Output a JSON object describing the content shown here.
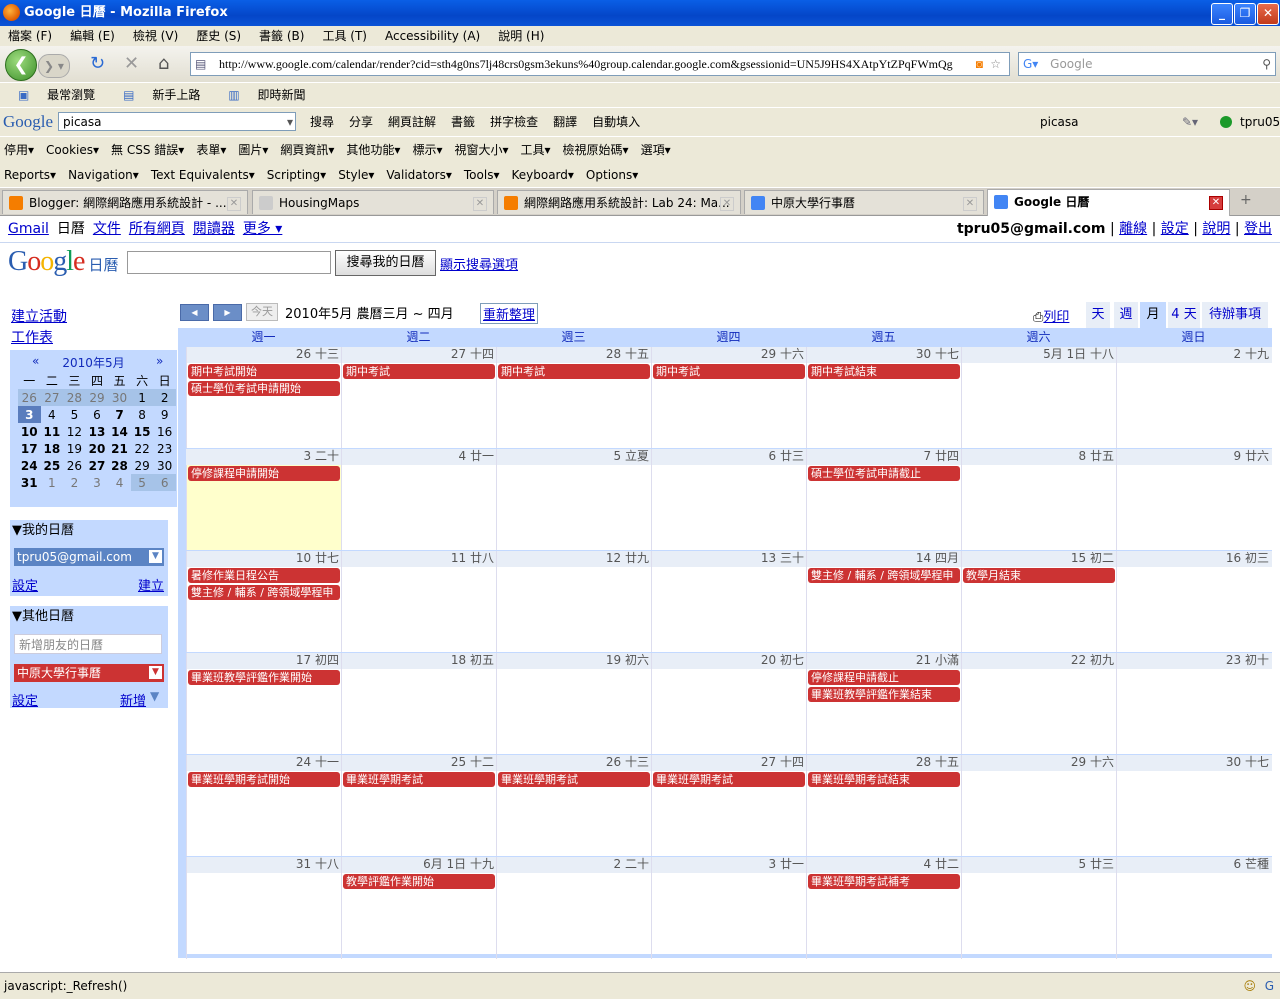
{
  "window": {
    "title": "Google 日曆 - Mozilla Firefox"
  },
  "menu": [
    "檔案 (F)",
    "編輯 (E)",
    "檢視 (V)",
    "歷史 (S)",
    "書籤 (B)",
    "工具 (T)",
    "Accessibility (A)",
    "說明 (H)"
  ],
  "nav": {
    "url": "http://www.google.com/calendar/render?cid=sth4g0ns7lj48crs0gsm3ekuns%40group.calendar.google.com&gsessionid=UN5J9HS4XAtpYtZPqFWmQg",
    "search_placeholder": "Google"
  },
  "bookmarks": [
    "最常瀏覽",
    "新手上路",
    "即時新聞"
  ],
  "gtoolbar": {
    "logo": "Google",
    "query": "picasa",
    "items": [
      "搜尋",
      "分享",
      "網頁註解",
      "書籤",
      "拼字檢查",
      "翻譯",
      "自動填入",
      "picasa"
    ],
    "user": "tpru05"
  },
  "devbar1": [
    "停用",
    "Cookies",
    "無 CSS 錯誤",
    "表單",
    "圖片",
    "網頁資訊",
    "其他功能",
    "標示",
    "視窗大小",
    "工具",
    "檢視原始碼",
    "選項"
  ],
  "devbar2": [
    "Reports",
    "Navigation",
    "Text Equivalents",
    "Scripting",
    "Style",
    "Validators",
    "Tools",
    "Keyboard",
    "Options"
  ],
  "tabs": [
    {
      "label": "Blogger: 網際網路應用系統設計 - ...",
      "color": "#f57d00"
    },
    {
      "label": "HousingMaps",
      "color": "#cccccc"
    },
    {
      "label": "網際網路應用系統設計: Lab 24: Ma...",
      "color": "#f57d00"
    },
    {
      "label": "中原大學行事曆",
      "color": "#4285f4"
    },
    {
      "label": "Google 日曆",
      "color": "#4285f4"
    }
  ],
  "gbar": {
    "links": [
      "Gmail",
      "日曆",
      "文件",
      "所有網頁",
      "閱讀器",
      "更多 ▾"
    ],
    "email": "tpru05@gmail.com",
    "right_links": [
      "離線",
      "設定",
      "說明",
      "登出"
    ]
  },
  "header": {
    "logo": "Google",
    "product": "日曆",
    "search_button": "搜尋我的日曆",
    "show_options": "顯示搜尋選項"
  },
  "sidebar": {
    "create_event": "建立活動",
    "tasks": "工作表",
    "minical": {
      "title": "2010年5月",
      "prev": "«",
      "next": "»",
      "weekdays": [
        "一",
        "二",
        "三",
        "四",
        "五",
        "六",
        "日"
      ],
      "weeks": [
        [
          "26",
          "27",
          "28",
          "29",
          "30",
          "1",
          "2"
        ],
        [
          "3",
          "4",
          "5",
          "6",
          "7",
          "8",
          "9"
        ],
        [
          "10",
          "11",
          "12",
          "13",
          "14",
          "15",
          "16"
        ],
        [
          "17",
          "18",
          "19",
          "20",
          "21",
          "22",
          "23"
        ],
        [
          "24",
          "25",
          "26",
          "27",
          "28",
          "29",
          "30"
        ],
        [
          "31",
          "1",
          "2",
          "3",
          "4",
          "5",
          "6"
        ]
      ]
    },
    "my_calendars": {
      "title": "▼我的日曆",
      "calendar": "tpru05@gmail.com",
      "color": "#5b84c4",
      "settings": "設定",
      "create": "建立"
    },
    "other_calendars": {
      "title": "▼其他日曆",
      "add_placeholder": "新增朋友的日曆",
      "calendar": "中原大學行事曆",
      "color": "#cc3333",
      "settings": "設定",
      "add": "新增"
    }
  },
  "calendar": {
    "today_button": "今天",
    "date_range": "2010年5月 農曆三月 ~ 四月",
    "refresh": "重新整理",
    "print": "列印",
    "views": [
      "天",
      "週",
      "月",
      "4 天",
      "待辦事項"
    ],
    "selected_view": "月",
    "day_headers": [
      "週一",
      "週二",
      "週三",
      "週四",
      "週五",
      "週六",
      "週日"
    ],
    "event_color": "#cc3333",
    "weeks": [
      {
        "dates": [
          "26 十三",
          "27 十四",
          "28 十五",
          "29 十六",
          "30 十七",
          "5月 1日 十八",
          "2 十九"
        ],
        "events": [
          {
            "day": 0,
            "row": 0,
            "span": 1,
            "title": "期中考試開始"
          },
          {
            "day": 0,
            "row": 1,
            "span": 1,
            "title": "碩士學位考試申請開始"
          },
          {
            "day": 1,
            "row": 0,
            "span": 1,
            "title": "期中考試"
          },
          {
            "day": 2,
            "row": 0,
            "span": 1,
            "title": "期中考試"
          },
          {
            "day": 3,
            "row": 0,
            "span": 1,
            "title": "期中考試"
          },
          {
            "day": 4,
            "row": 0,
            "span": 1,
            "title": "期中考試結束"
          }
        ]
      },
      {
        "dates": [
          "3 二十",
          "4 廿一",
          "5 立夏",
          "6 廿三",
          "7 廿四",
          "8 廿五",
          "9 廿六"
        ],
        "events": [
          {
            "day": 0,
            "row": 0,
            "span": 1,
            "title": "停修課程申請開始"
          },
          {
            "day": 4,
            "row": 0,
            "span": 1,
            "title": "碩士學位考試申請截止"
          }
        ]
      },
      {
        "dates": [
          "10 廿七",
          "11 廿八",
          "12 廿九",
          "13 三十",
          "14 四月",
          "15 初二",
          "16 初三"
        ],
        "events": [
          {
            "day": 0,
            "row": 0,
            "span": 1,
            "title": "暑修作業日程公告"
          },
          {
            "day": 0,
            "row": 1,
            "span": 1,
            "title": "雙主修 / 輔系 / 跨領域學程申"
          },
          {
            "day": 4,
            "row": 0,
            "span": 1,
            "title": "雙主修 / 輔系 / 跨領域學程申"
          },
          {
            "day": 5,
            "row": 0,
            "span": 1,
            "title": "教學月結束"
          }
        ]
      },
      {
        "dates": [
          "17 初四",
          "18 初五",
          "19 初六",
          "20 初七",
          "21 小滿",
          "22 初九",
          "23 初十"
        ],
        "events": [
          {
            "day": 0,
            "row": 0,
            "span": 1,
            "title": "畢業班教學評鑑作業開始"
          },
          {
            "day": 4,
            "row": 0,
            "span": 1,
            "title": "停修課程申請截止"
          },
          {
            "day": 4,
            "row": 1,
            "span": 1,
            "title": "畢業班教學評鑑作業結束"
          }
        ]
      },
      {
        "dates": [
          "24 十一",
          "25 十二",
          "26 十三",
          "27 十四",
          "28 十五",
          "29 十六",
          "30 十七"
        ],
        "events": [
          {
            "day": 0,
            "row": 0,
            "span": 1,
            "title": "畢業班學期考試開始"
          },
          {
            "day": 1,
            "row": 0,
            "span": 1,
            "title": "畢業班學期考試"
          },
          {
            "day": 2,
            "row": 0,
            "span": 1,
            "title": "畢業班學期考試"
          },
          {
            "day": 3,
            "row": 0,
            "span": 1,
            "title": "畢業班學期考試"
          },
          {
            "day": 4,
            "row": 0,
            "span": 1,
            "title": "畢業班學期考試結束"
          }
        ]
      },
      {
        "dates": [
          "31 十八",
          "6月 1日 十九",
          "2 二十",
          "3 廿一",
          "4 廿二",
          "5 廿三",
          "6 芒種"
        ],
        "events": [
          {
            "day": 1,
            "row": 0,
            "span": 1,
            "title": "教學評鑑作業開始"
          },
          {
            "day": 4,
            "row": 0,
            "span": 1,
            "title": "畢業班學期考試補考"
          }
        ]
      }
    ]
  },
  "status": {
    "text": "javascript:_Refresh()"
  }
}
